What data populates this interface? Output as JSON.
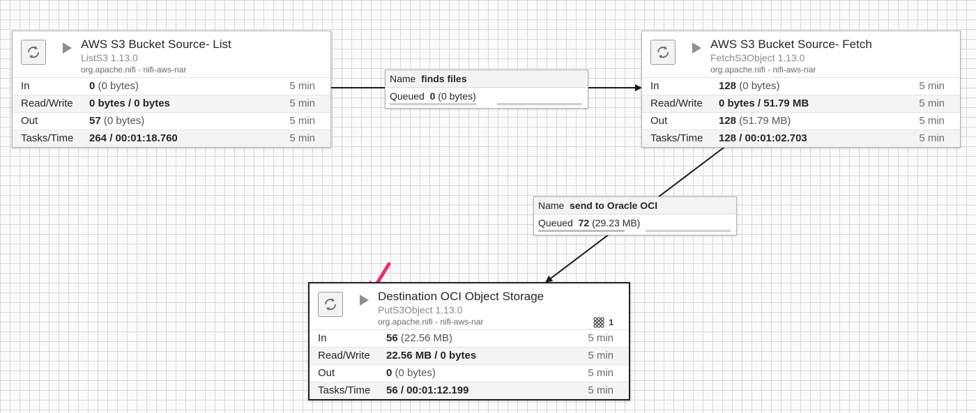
{
  "colors": {
    "grid": "#d9d9d9",
    "connector": "#1a1a1a",
    "annotation_arrow": "#ec2f67"
  },
  "processors": [
    {
      "title": "AWS S3 Bucket Source- List",
      "type": "ListS3 1.13.0",
      "bundle": "org.apache.nifi - nifi-aws-nar",
      "icon": "processor-icon",
      "state": "stopped",
      "stats": [
        {
          "label": "In",
          "bold": "0",
          "normal": " (0 bytes)",
          "time": "5 min"
        },
        {
          "label": "Read/Write",
          "bold": "0 bytes / 0 bytes",
          "normal": "",
          "time": "5 min"
        },
        {
          "label": "Out",
          "bold": "57",
          "normal": " (0 bytes)",
          "time": "5 min"
        },
        {
          "label": "Tasks/Time",
          "bold": "264 / 00:01:18.760",
          "normal": "",
          "time": "5 min"
        }
      ]
    },
    {
      "title": "AWS S3 Bucket Source- Fetch",
      "type": "FetchS3Object 1.13.0",
      "bundle": "org.apache.nifi - nifi-aws-nar",
      "icon": "processor-icon",
      "state": "stopped",
      "stats": [
        {
          "label": "In",
          "bold": "128",
          "normal": " (0 bytes)",
          "time": "5 min"
        },
        {
          "label": "Read/Write",
          "bold": "0 bytes / 51.79 MB",
          "normal": "",
          "time": "5 min"
        },
        {
          "label": "Out",
          "bold": "128",
          "normal": " (51.79 MB)",
          "time": "5 min"
        },
        {
          "label": "Tasks/Time",
          "bold": "128 / 00:01:02.703",
          "normal": "",
          "time": "5 min"
        }
      ]
    },
    {
      "title": "Destination OCI Object Storage",
      "type": "PutS3Object 1.13.0",
      "bundle": "org.apache.nifi - nifi-aws-nar",
      "icon": "processor-icon",
      "state": "stopped",
      "active_threads": "1",
      "stats": [
        {
          "label": "In",
          "bold": "56",
          "normal": " (22.56 MB)",
          "time": "5 min"
        },
        {
          "label": "Read/Write",
          "bold": "22.56 MB / 0 bytes",
          "normal": "",
          "time": "5 min"
        },
        {
          "label": "Out",
          "bold": "0",
          "normal": " (0 bytes)",
          "time": "5 min"
        },
        {
          "label": "Tasks/Time",
          "bold": "56 / 00:01:12.199",
          "normal": "",
          "time": "5 min"
        }
      ]
    }
  ],
  "connections": [
    {
      "name_label": "Name",
      "name": "finds files",
      "queued_label": "Queued",
      "queued_count": "0",
      "queued_size": " (0 bytes)"
    },
    {
      "name_label": "Name",
      "name": "send to Oracle OCI",
      "queued_label": "Queued",
      "queued_count": "72",
      "queued_size": " (29.23 MB)"
    }
  ]
}
